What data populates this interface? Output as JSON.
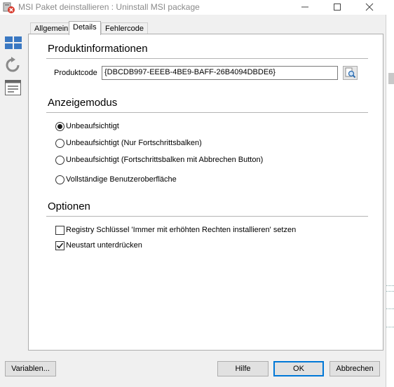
{
  "window": {
    "title": "MSI Paket deinstallieren : Uninstall MSI package"
  },
  "tabs": [
    {
      "label": "Allgemein"
    },
    {
      "label": "Details"
    },
    {
      "label": "Fehlercode"
    }
  ],
  "produktinfo": {
    "heading": "Produktinformationen",
    "productcode_label": "Produktcode",
    "productcode_value": "{DBCDB997-EEEB-4BE9-BAFF-26B4094DBDE6}"
  },
  "anzeigemodus": {
    "heading": "Anzeigemodus",
    "options": [
      {
        "label": "Unbeaufsichtigt",
        "selected": true
      },
      {
        "label": "Unbeaufsichtigt (Nur Fortschrittsbalken)",
        "selected": false
      },
      {
        "label": "Unbeaufsichtigt (Fortschrittsbalken mit Abbrechen Button)",
        "selected": false
      },
      {
        "label": "Vollständige Benutzeroberfläche",
        "selected": false
      }
    ]
  },
  "optionen": {
    "heading": "Optionen",
    "checkboxes": [
      {
        "label": "Registry Schlüssel 'Immer mit erhöhten Rechten installieren' setzen",
        "checked": false
      },
      {
        "label": "Neustart unterdrücken",
        "checked": true
      }
    ]
  },
  "buttons": {
    "variables": "Variablen...",
    "help": "Hilfe",
    "ok": "OK",
    "cancel": "Abbrechen"
  },
  "colors": {
    "accent": "#0078d7",
    "sidebar_icon": "#3a78c2"
  }
}
